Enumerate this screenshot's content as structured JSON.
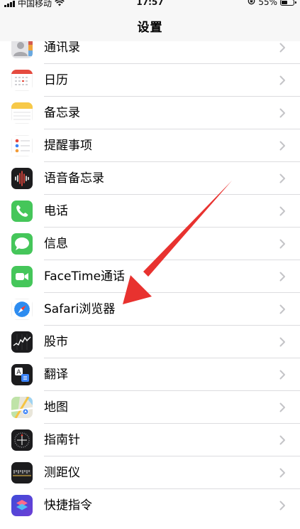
{
  "status_bar": {
    "carrier": "中国移动",
    "time": "17:57",
    "battery_text": "55%",
    "battery_level": 0.55
  },
  "nav": {
    "title": "设置"
  },
  "list": {
    "items": [
      {
        "label": "通讯录",
        "icon": "contacts-icon"
      },
      {
        "label": "日历",
        "icon": "calendar-icon"
      },
      {
        "label": "备忘录",
        "icon": "notes-icon"
      },
      {
        "label": "提醒事项",
        "icon": "reminders-icon"
      },
      {
        "label": "语音备忘录",
        "icon": "voice-memos-icon"
      },
      {
        "label": "电话",
        "icon": "phone-icon"
      },
      {
        "label": "信息",
        "icon": "messages-icon"
      },
      {
        "label": "FaceTime通话",
        "icon": "facetime-icon"
      },
      {
        "label": "Safari浏览器",
        "icon": "safari-icon"
      },
      {
        "label": "股市",
        "icon": "stocks-icon"
      },
      {
        "label": "翻译",
        "icon": "translate-icon"
      },
      {
        "label": "地图",
        "icon": "maps-icon"
      },
      {
        "label": "指南针",
        "icon": "compass-icon"
      },
      {
        "label": "测距仪",
        "icon": "measure-icon"
      },
      {
        "label": "快捷指令",
        "icon": "shortcuts-icon"
      }
    ]
  },
  "colors": {
    "arrow": "#e8322f",
    "separator": "#dcdcdf",
    "chevron": "#c4c4c7",
    "bar_background": "#f7f7f7"
  }
}
